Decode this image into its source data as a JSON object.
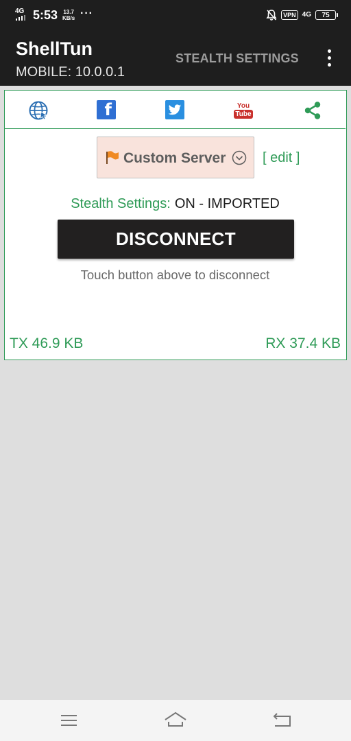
{
  "status_bar": {
    "network_type": "4G",
    "time": "5:53",
    "speed_value": "13.7",
    "speed_unit": "KB/s",
    "overflow_dots": "···",
    "vpn_label": "VPN",
    "network_type_right": "4G",
    "battery_level": "75",
    "icons": [
      "signal-icon",
      "notifications-off-icon",
      "vpn-icon",
      "battery-icon"
    ]
  },
  "toolbar": {
    "title": "ShellTun",
    "subtitle": "MOBILE: 10.0.0.1",
    "action_label": "STEALTH SETTINGS",
    "overflow_icon": "more-vert-icon"
  },
  "social_links": [
    {
      "icon": "globe-icon",
      "color": "#2b6fb3"
    },
    {
      "icon": "facebook-icon",
      "color": "#2f6fd3"
    },
    {
      "icon": "twitter-icon",
      "color": "#2a8fe0"
    },
    {
      "icon": "youtube-icon",
      "color": "#c9302c"
    },
    {
      "icon": "share-icon",
      "color": "#2f9b57"
    }
  ],
  "server": {
    "label": "Custom Server",
    "flag_icon": "flag-icon",
    "dropdown_icon": "chevron-down-circle-icon",
    "edit_label": "[ edit ]"
  },
  "stealth": {
    "key": "Stealth Settings:",
    "value": "ON - IMPORTED"
  },
  "connection": {
    "button_label": "DISCONNECT",
    "hint": "Touch button above to disconnect"
  },
  "traffic": {
    "tx": "TX 46.9 KB",
    "rx": "RX 37.4 KB"
  },
  "navigation_bar": {
    "icons": [
      "menu-icon",
      "home-icon",
      "back-icon"
    ]
  },
  "colors": {
    "accent": "#2f9b57",
    "toolbar_bg": "#1e1e1e",
    "button_bg": "#222020",
    "server_bg": "#f9e3dc",
    "page_bg": "#dedede"
  }
}
